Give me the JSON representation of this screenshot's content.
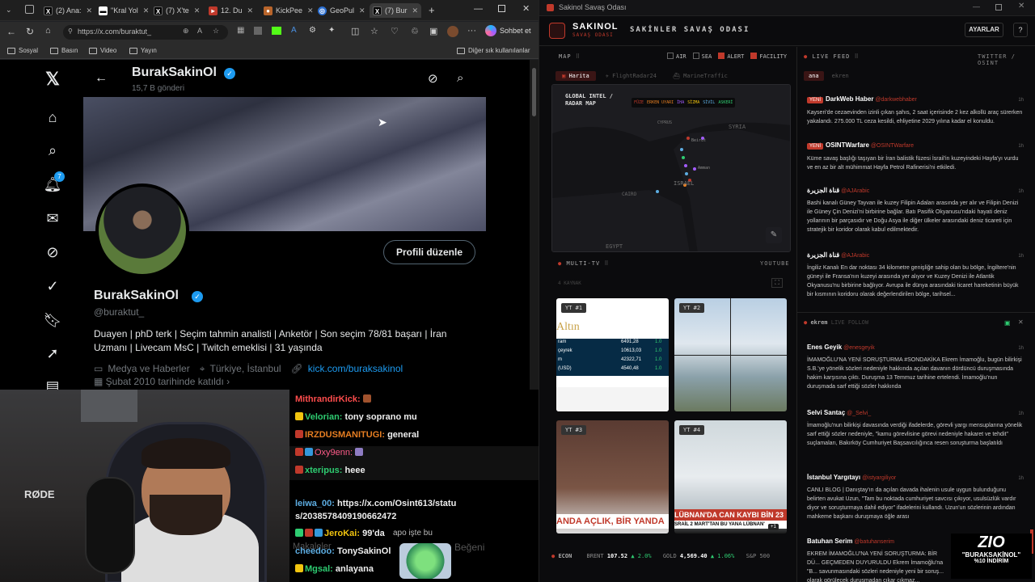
{
  "browser": {
    "tabs": [
      {
        "label": "(2) Ana:",
        "icon": "x-icon"
      },
      {
        "label": "\"Kral Yol",
        "icon": "news-icon"
      },
      {
        "label": "(7) X'te",
        "icon": "x-icon"
      },
      {
        "label": "12. Du",
        "icon": "video-icon"
      },
      {
        "label": "KickPee",
        "icon": "kick-icon"
      },
      {
        "label": "GeoPul",
        "icon": "globe-icon"
      },
      {
        "label": "(7) Bur",
        "icon": "x-icon"
      }
    ],
    "url": "https://x.com/buraktut_",
    "chat_label": "Sohbet et",
    "bookmarks": [
      "Sosyal",
      "Basın",
      "Video",
      "Yayın"
    ],
    "bookmarks_other": "Diğer sık kullanılanlar"
  },
  "profile": {
    "header_name": "BurakSakinOl",
    "header_posts": "15,7 B gönderi",
    "name": "BurakSakinOl",
    "handle": "@buraktut_",
    "bio": "Duayen | phD terk | Seçim tahmin analisti | Anketör | Son seçim 78/81 başarı | İran Uzmanı | Livecam MsC | Twitch emeklisi | 31 yaşında",
    "category": "Medya ve Haberler",
    "location": "Türkiye, İstanbul",
    "link": "kick.com/buraksakinol",
    "joined": "Şubat 2010 tarihinde katıldı",
    "edit_label": "Profili düzenle",
    "notif_count": "7"
  },
  "chat": {
    "messages": [
      {
        "user": "MithrandirKick:",
        "text": "",
        "color": "#ff4d4d"
      },
      {
        "user": "Velorian:",
        "text": "tony soprano mu",
        "color": "#2ecc71"
      },
      {
        "user": "IRZDUSMANITUGI:",
        "text": "general",
        "color": "#e67e22"
      },
      {
        "user": "Oxy9enn:",
        "text": "",
        "color": "#ff5c8a"
      },
      {
        "user": "xteripus:",
        "text": "heee",
        "color": "#2ecc71"
      },
      {
        "user": "leiwa_00:",
        "text": "https://x.com/Osint613/status/2038578409190662472",
        "color": "#5dade2"
      },
      {
        "user": "JeroKai:",
        "text": "99'da",
        "color": "#f1c40f"
      },
      {
        "user": "cheedoo:",
        "text": "TonySakinOl",
        "color": "#5dade2"
      },
      {
        "user": "Mgsal:",
        "text": "anlayana",
        "color": "#2ecc71"
      }
    ],
    "overlay": "apo işte bu",
    "behind_1": "Makaleler",
    "behind_2": "Beğeni"
  },
  "cam": {
    "mic_brand": "RØDE"
  },
  "dash": {
    "window_title": "Sakinol Savaş Odası",
    "brand": "SAKINOL",
    "brand_sub": "SAVAŞ ODASI",
    "room_title": "SAKİNLER SAVAŞ ODASI",
    "settings": "AYARLAR",
    "help": "?",
    "map_label": "MAP",
    "filters": [
      {
        "label": "AIR",
        "on": false
      },
      {
        "label": "SEA",
        "on": false
      },
      {
        "label": "ALERT",
        "on": true
      },
      {
        "label": "FACILITY",
        "on": true
      }
    ],
    "map_tabs": [
      "Harita",
      "FlightRadar24",
      "MarineTraffic"
    ],
    "map_title": "GLOBAL INTEL / RADAR MAP",
    "legend": [
      "FÜZE",
      "ERKEN UYARI",
      "İHA",
      "SİZMA",
      "SİVİL",
      "ASKERİ"
    ],
    "places": [
      "SYRIA",
      "ISRAEL",
      "CAIRO",
      "EGYPT",
      "Amman",
      "Beirut",
      "CYPRUS"
    ],
    "live_feed": "LIVE FEED",
    "feed_sources": "TWITTER / OSINT",
    "feed_tabs": [
      "ana",
      "ekren"
    ],
    "feed": [
      {
        "name": "DarkWeb Haber",
        "handle": "@darkwebhaber",
        "new": true,
        "time": "1h",
        "text": "Kayseri'de cezaevinden izinli çıkan şahıs, 2 saat içerisinde 2 kez alkollü araç sürerken yakalandı. 275.000 TL ceza kesildi, ehliyetine 2029 yılına kadar el konuldu."
      },
      {
        "name": "OSINTWarfare",
        "handle": "@OSINTWarfare",
        "new": true,
        "time": "1h",
        "text": "Küme savaş başlığı taşıyan bir İran balistik füzesi İsrail'in kuzeyindeki Hayfa'yı vurdu ve en az bir alt mühimmat Hayfa Petrol Rafinerisi'ni etkiledi."
      },
      {
        "name": "قناة الجزيرة",
        "handle": "@AJArabic",
        "new": false,
        "time": "1h",
        "text": "Bashi kanalı Güney Tayvan ile kuzey Filipin Adaları arasında yer alır ve Filipin Denizi ile Güney Çin Denizi'ni birbirine bağlar. Batı Pasifik Okyanusu'ndaki hayati deniz yollarının bir parçasıdır ve Doğu Asya ile diğer ülkeler arasındaki deniz ticareti için stratejik bir koridor olarak kabul edilmektedir."
      },
      {
        "name": "قناة الجزيرة",
        "handle": "@AJArabic",
        "new": false,
        "time": "1h",
        "text": "İngiliz Kanalı En dar noktası 34 kilometre genişliğe sahip olan bu bölge, İngiltere'nin güneyi ile Fransa'nın kuzeyi arasında yer alıyor ve Kuzey Denizi ile Atlantik Okyanusu'nu birbirine bağlıyor. Avrupa ile dünya arasındaki ticaret hareketinin büyük bir kısmının koridoru olarak değerlendirilen bölge, tarihsel..."
      }
    ],
    "feed2_title": "ekrem",
    "feed2_sub": "LIVE FOLLOW",
    "feed2": [
      {
        "name": "Enes Geyik",
        "handle": "@enesgeyik",
        "time": "1h",
        "text": "İMAMOĞLU'NA YENİ SORUŞTURMA #SONDAKİKA Ekrem İmamoğlu, bugün bilirkişi S.B.'ye yönelik sözleri nedeniyle hakkında açılan davanın dördüncü duruşmasında hakim karşısına çıktı. Duruşma 13 Temmuz tarihine ertelendi. İmamoğlu'nun duruşmada sarf ettiği sözler hakkında"
      },
      {
        "name": "Selvi Santaç",
        "handle": "@_Selvi_",
        "time": "1h",
        "text": "İmamoğlu'nun bilirkişi davasında verdiği ifadelerde, görevli yargı mensuplarına yönelik sarf ettiği sözler nedeniyle, \"kamu görevlisine görevi nedeniyle hakaret ve tehdit\" suçlamaları, Bakırköy Cumhuriyet Başsavcılığınca resen soruşturma başlatıldı"
      },
      {
        "name": "İstanbul Yargıtayı",
        "handle": "@istyargiliyor",
        "time": "1h",
        "text": "CANLI BLOG | Danıştay'ın da açılan davada ihalenin usule uygun bulunduğunu belirten avukat Uzun, \"Tam bu noktada cumhuriyet savcısı çıkıyor, usulsüzlük vardır diyor ve soruşturmaya dahil ediyor\" ifadelerini kullandı. Uzun'un sözlerinin ardından mahkeme başkanı duruşmaya öğle arası"
      },
      {
        "name": "Batuhan Serim",
        "handle": "@batuhanserim",
        "time": "1h",
        "text": "EKREM İMAMOĞLU'NA YENİ SORUŞTURMA: BİR DÜ... GEÇMEDEN DUYURULDU Ekrem İmamoğlu'na \"B... savunmasındaki sözleri nedeniyle yeni bir soruş... olarak görülecek duruşmadan çıkar çıkmaz..."
      }
    ],
    "multitv": "MULTI-TV",
    "youtube": "YOUTUBE",
    "tv_sub": "4 KAYNAK",
    "tiles": [
      {
        "tag": "YT #1"
      },
      {
        "tag": "YT #2"
      },
      {
        "tag": "YT #3"
      },
      {
        "tag": "YT #4"
      }
    ],
    "tv1_title": "Altın",
    "tv1_rows": [
      {
        "k": "ram",
        "v": "6491,28",
        "c": "1.0"
      },
      {
        "k": "çeyrek",
        "v": "10613,03",
        "c": "1.0"
      },
      {
        "k": "m",
        "v": "42322,71",
        "c": "1.0"
      },
      {
        "k": "(USD)",
        "v": "4540,48",
        "c": "1.0"
      }
    ],
    "tv3_caption": "ANDA AÇLIK, BİR YANDA",
    "tv4_caption": "LÜBNAN'DA CAN KAYBI BİN 23",
    "tv4_sub": "SRAİL 2 MART'TAN BU YANA LÜBNAN'",
    "tv4_plus": "+1",
    "ticker": [
      {
        "k": "ECON",
        "v": "",
        "c": ""
      },
      {
        "k": "BRENT",
        "v": "107.52",
        "c": "▲ 2.0%"
      },
      {
        "k": "GOLD",
        "v": "4,569.40",
        "c": "▲ 1.06%"
      },
      {
        "k": "S&P 500",
        "v": "",
        "c": ""
      }
    ],
    "promo_logo": "ZIO",
    "promo_code": "\"BURAKSAKİNOL\"",
    "promo_text": "%10 İNDİRİM"
  }
}
